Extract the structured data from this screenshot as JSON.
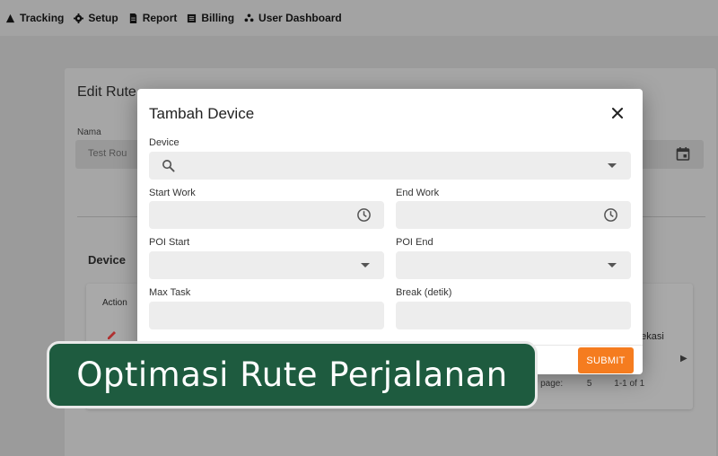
{
  "nav": {
    "items": [
      {
        "label": "Tracking",
        "icon": "triangle-icon"
      },
      {
        "label": "Setup",
        "icon": "gear-icon"
      },
      {
        "label": "Report",
        "icon": "document-icon"
      },
      {
        "label": "Billing",
        "icon": "billing-icon"
      },
      {
        "label": "User Dashboard",
        "icon": "users-icon"
      }
    ]
  },
  "background_page": {
    "title": "Edit Rute",
    "nama_label": "Nama",
    "nama_value": "Test Rou",
    "device_section": "Device",
    "table": {
      "action_header": "Action",
      "partial_cell": "bekasi",
      "rows_per_page_label": "r page:",
      "rows_per_page_value": "5",
      "pagination": "1-1 of 1"
    }
  },
  "modal": {
    "title": "Tambah Device",
    "fields": {
      "device": {
        "label": "Device",
        "value": ""
      },
      "start_work": {
        "label": "Start Work",
        "value": ""
      },
      "end_work": {
        "label": "End Work",
        "value": ""
      },
      "poi_start": {
        "label": "POI Start",
        "value": ""
      },
      "poi_end": {
        "label": "POI End",
        "value": ""
      },
      "max_task": {
        "label": "Max Task",
        "value": ""
      },
      "break": {
        "label": "Break (detik)",
        "value": ""
      }
    },
    "submit_label": "SUBMIT"
  },
  "banner": {
    "text": "Optimasi Rute Perjalanan"
  },
  "colors": {
    "accent": "#f57c1f",
    "banner_bg": "#1e5b3f",
    "overlay": "#9b9b9b"
  }
}
